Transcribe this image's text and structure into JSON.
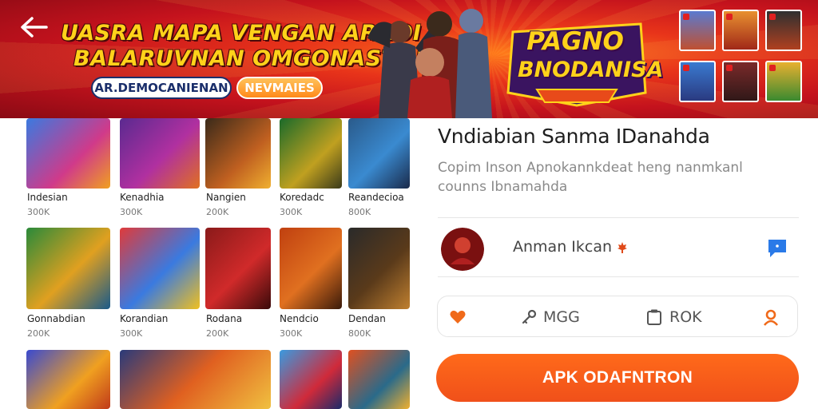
{
  "banner": {
    "back_icon": "arrow-left-icon",
    "headline_line1": "UASRA MAPA VENGAN ARROI",
    "headline_line2": "BALARUVNAN OMGONASTOIH!",
    "pill_blue": "AR.DEMOCANIENAN",
    "pill_orange": "NEVMAIES",
    "logo_line1": "PAGNO",
    "logo_line2": "BNODANISA",
    "colors": {
      "red": "#c4121d",
      "orange": "#ff7a1a",
      "yellow": "#ffd21a"
    }
  },
  "games": [
    {
      "title": "Indesian",
      "count": "300K"
    },
    {
      "title": "Kenadhia",
      "count": "300K"
    },
    {
      "title": "Nangien",
      "count": "200K"
    },
    {
      "title": "Koredadc",
      "count": "300K"
    },
    {
      "title": "Reandecioa",
      "count": "800K"
    },
    {
      "title": "Gonnabdian",
      "count": "200K"
    },
    {
      "title": "Korandian",
      "count": "300K"
    },
    {
      "title": "Rodana",
      "count": "200K"
    },
    {
      "title": "Nendcio",
      "count": "300K"
    },
    {
      "title": "Dendan",
      "count": "800K"
    },
    {
      "title": "",
      "count": ""
    },
    {
      "title": "",
      "count": ""
    },
    {
      "title": "",
      "count": ""
    },
    {
      "title": "",
      "count": ""
    }
  ],
  "app": {
    "title": "Vndiabian Sanma IDanahda",
    "description_line1": "Copim Inson Apnokannkdeat heng nanmkanl",
    "description_line2": "counns Ibnamahda",
    "developer": "Anman Ikcan",
    "stats": [
      {
        "icon": "heart-icon",
        "label": ""
      },
      {
        "icon": "key-icon",
        "label": "MGG"
      },
      {
        "icon": "clipboard-icon",
        "label": "ROK"
      },
      {
        "icon": "person-icon",
        "label": ""
      }
    ],
    "install_label": "APK ODAFNTRON",
    "accent_color": "#f0501a",
    "chat_icon": "chat-icon"
  }
}
